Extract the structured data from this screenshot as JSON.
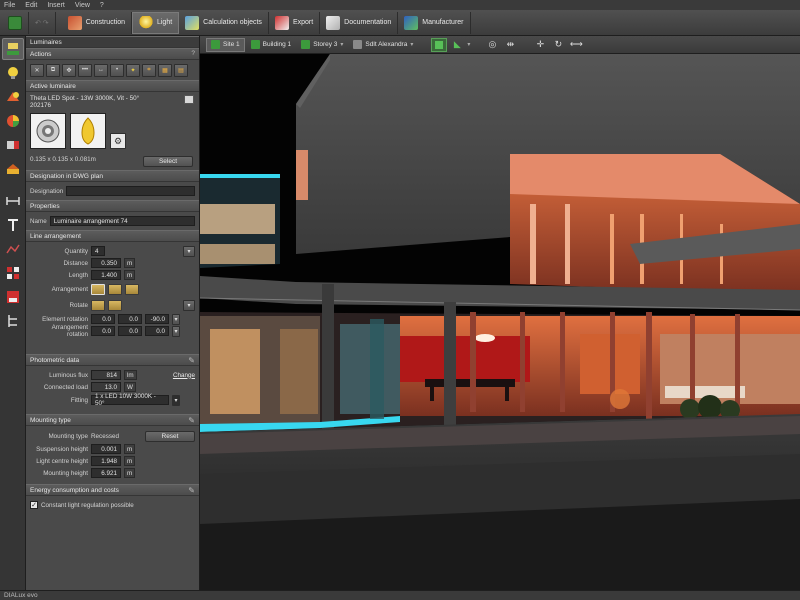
{
  "menu": [
    "File",
    "Edit",
    "Insert",
    "View",
    "?"
  ],
  "toolbar": {
    "buttons": [
      {
        "label": "Construction",
        "icon": "construction-icon"
      },
      {
        "label": "Light",
        "icon": "light-icon",
        "active": true
      },
      {
        "label": "Calculation objects",
        "icon": "calculation-icon"
      },
      {
        "label": "Export",
        "icon": "export-icon"
      },
      {
        "label": "Documentation",
        "icon": "documentation-icon"
      },
      {
        "label": "Manufacturer",
        "icon": "manufacturer-icon"
      }
    ]
  },
  "viewbar": {
    "site": "Site 1",
    "building": "Building 1",
    "storey": "Storey 3",
    "dwg": "Sdlt Alexandra"
  },
  "panel": {
    "title": "Luminaires",
    "actions": {
      "title": "Actions",
      "help": "?"
    },
    "active_luminaire": {
      "title": "Active luminaire",
      "name": "Theta LED Spot - 13W 3000K, Vit - 50°",
      "code": "202176",
      "dims": "0.135 x 0.135 x 0.081m",
      "select_label": "Select"
    },
    "designation": {
      "title": "Designation in DWG plan",
      "label": "Designation",
      "value": ""
    },
    "properties": {
      "title": "Properties",
      "name_label": "Name",
      "name_value": "Luminaire arrangement 74"
    },
    "line_arrangement": {
      "title": "Line arrangement",
      "quantity_label": "Quantity",
      "quantity_value": "4",
      "distance_label": "Distance",
      "distance_value": "0.350",
      "distance_unit": "m",
      "length_label": "Length",
      "length_value": "1.400",
      "length_unit": "m",
      "arrangement_label": "Arrangement",
      "rotate_label": "Rotate",
      "element_rotation_label": "Element rotation",
      "element_rotation": [
        "0.0",
        "0.0",
        "-90.0"
      ],
      "arrangement_rotation_label": "Arrangement rotation",
      "arrangement_rotation": [
        "0.0",
        "0.0",
        "0.0"
      ]
    },
    "photometric": {
      "title": "Photometric data",
      "flux_label": "Luminous flux",
      "flux_value": "814",
      "flux_unit": "lm",
      "change_label": "Change",
      "load_label": "Connected load",
      "load_value": "13.0",
      "load_unit": "W",
      "fitting_label": "Fitting",
      "fitting_value": "1 x LED 10W 3000K - 50°"
    },
    "mounting": {
      "title": "Mounting type",
      "type_label": "Mounting type",
      "type_value": "Recessed",
      "reset_label": "Reset",
      "suspension_label": "Suspension height",
      "suspension_value": "0.001",
      "suspension_unit": "m",
      "centre_label": "Light centre height",
      "centre_value": "1.948",
      "centre_unit": "m",
      "mounting_label": "Mounting height",
      "mounting_value": "6.921",
      "mounting_unit": "m"
    },
    "energy": {
      "title": "Energy consumption and costs",
      "checkbox_label": "Constant light regulation possible",
      "checked": true
    }
  },
  "status": {
    "app": "DIALux evo"
  },
  "colors": {
    "accent_green": "#3c9a3c",
    "warm_light": "#ff7a4a",
    "cool_light": "#38d8f0"
  }
}
